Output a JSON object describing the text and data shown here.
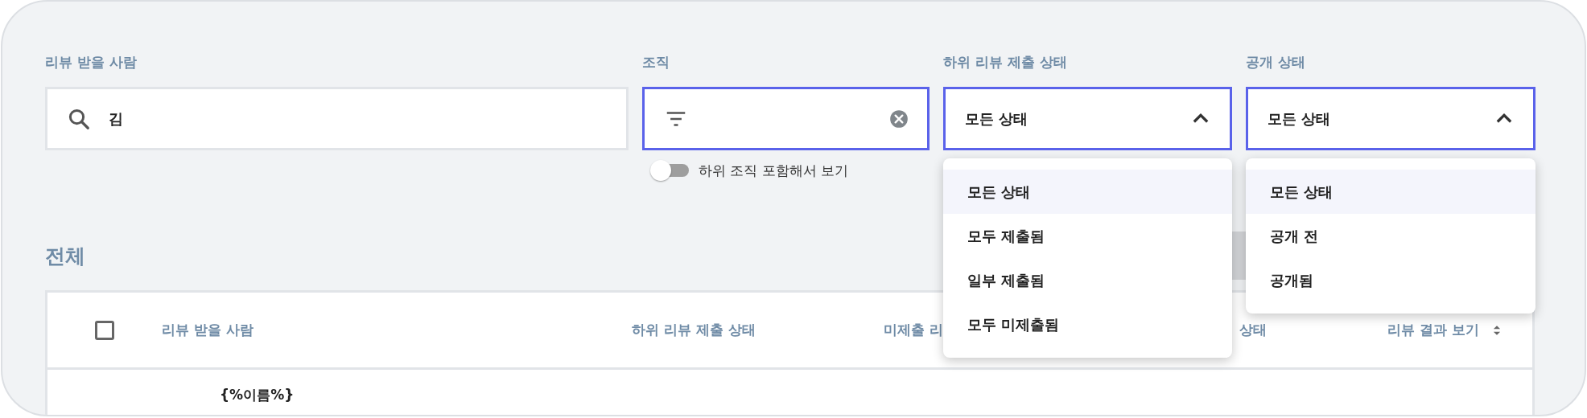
{
  "filters": [
    {
      "kind": "search",
      "label": "리뷰 받을 사람",
      "value": "김",
      "focused": false
    },
    {
      "kind": "filter",
      "label": "조직",
      "focused": true,
      "toggle": {
        "label": "하위 조직 포함해서 보기",
        "on": false
      }
    },
    {
      "kind": "select",
      "label": "하위 리뷰 제출 상태",
      "value": "모든 상태",
      "expanded": true,
      "focused": true,
      "options": [
        {
          "label": "모든 상태",
          "selected": true
        },
        {
          "label": "모두 제출됨",
          "selected": false
        },
        {
          "label": "일부 제출됨",
          "selected": false
        },
        {
          "label": "모두 미제출됨",
          "selected": false
        }
      ]
    },
    {
      "kind": "select",
      "label": "공개 상태",
      "value": "모든 상태",
      "expanded": true,
      "focused": true,
      "options": [
        {
          "label": "모든 상태",
          "selected": true
        },
        {
          "label": "공개 전",
          "selected": false
        },
        {
          "label": "공개됨",
          "selected": false
        }
      ]
    }
  ],
  "section": {
    "title": "전체"
  },
  "table": {
    "select_all": {
      "checked": false
    },
    "columns": [
      {
        "label": "리뷰 받을 사람"
      },
      {
        "label": "하위 리뷰 제출 상태"
      },
      {
        "label": "미제출 리"
      },
      {
        "label": "상태"
      },
      {
        "label": "리뷰 결과 보기",
        "sortable": true
      }
    ],
    "rows": [
      {
        "name": "{%이름%}"
      }
    ]
  }
}
